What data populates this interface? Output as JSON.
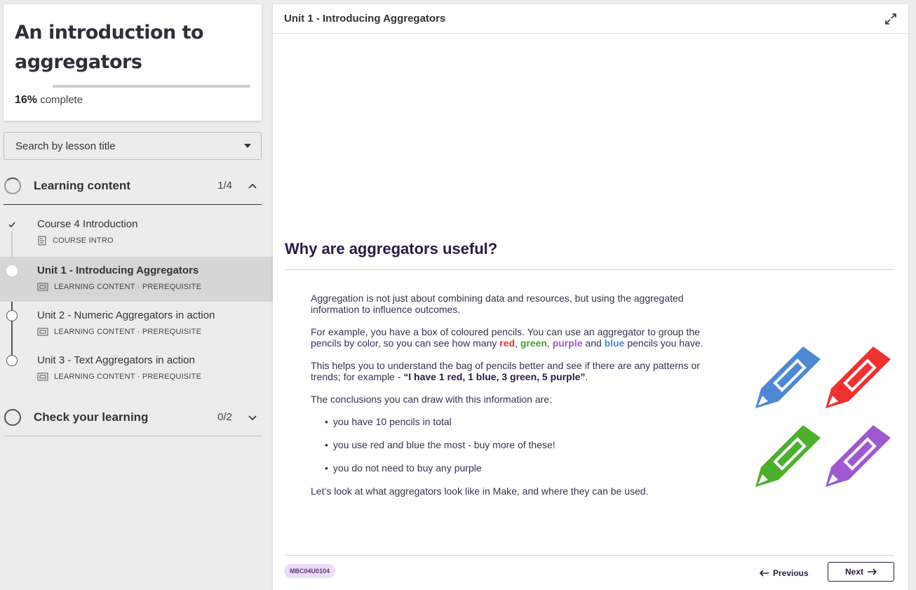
{
  "course": {
    "title": "An introduction to aggregators",
    "progress_percent": "16%",
    "progress_suffix": "complete",
    "progress_fraction": 0.16
  },
  "search": {
    "placeholder": "Search by lesson title"
  },
  "sections": [
    {
      "label": "Learning content",
      "count": "1/4",
      "lessons": [
        {
          "title": "Course 4 Introduction",
          "meta": "COURSE INTRO",
          "state": "done"
        },
        {
          "title": "Unit 1 - Introducing Aggregators",
          "meta": "LEARNING CONTENT · PREREQUISITE",
          "state": "active"
        },
        {
          "title": "Unit 2 - Numeric Aggregators in action",
          "meta": "LEARNING CONTENT · PREREQUISITE",
          "state": "todo"
        },
        {
          "title": "Unit 3 - Text Aggregators in action",
          "meta": "LEARNING CONTENT · PREREQUISITE",
          "state": "todo"
        }
      ]
    },
    {
      "label": "Check your learning",
      "count": "0/2"
    }
  ],
  "main": {
    "unit_title": "Unit 1 - Introducing Aggregators",
    "heading": "Why are aggregators useful?",
    "para1": "Aggregation is not just about combining data and resources, but using the aggregated information to influence outcomes.",
    "para2_a": "For example, you have a box of coloured pencils. You can use an aggregator to group the pencils by color, so you can see how many ",
    "red": "red",
    "comma1": ", ",
    "green": "green",
    "comma2": ", ",
    "purple": "purple",
    "and": " and ",
    "blue": "blue",
    "para2_b": " pencils you have.",
    "para3_a": "This helps you to understand the bag of pencils better and see if there are any patterns or trends; for example - ",
    "para3_quote": "“I have 1 red, 1 blue, 3 green, 5 purple”",
    "para3_end": ".",
    "para4": "The conclusions you can draw with this information are:",
    "bullets": [
      "you have 10 pencils in total",
      "you use red and blue the most - buy more of these!",
      "you do not need to buy any purple"
    ],
    "para5": "Let’s look at what aggregators look like in Make, and where they can be used.",
    "code": "MBC04U0104",
    "prev_label": "Previous",
    "next_label": "Next"
  },
  "colors": {
    "red": "#e8322f",
    "green": "#3fa12c",
    "purple": "#9e59d0",
    "blue": "#4d88d4",
    "brand_dark": "#2a1a45"
  },
  "icons": [
    "check-icon",
    "document-icon",
    "slides-icon",
    "chevron-up-icon",
    "chevron-down-icon",
    "expand-icon",
    "arrow-left-icon",
    "arrow-right-icon",
    "pencil-icon"
  ]
}
